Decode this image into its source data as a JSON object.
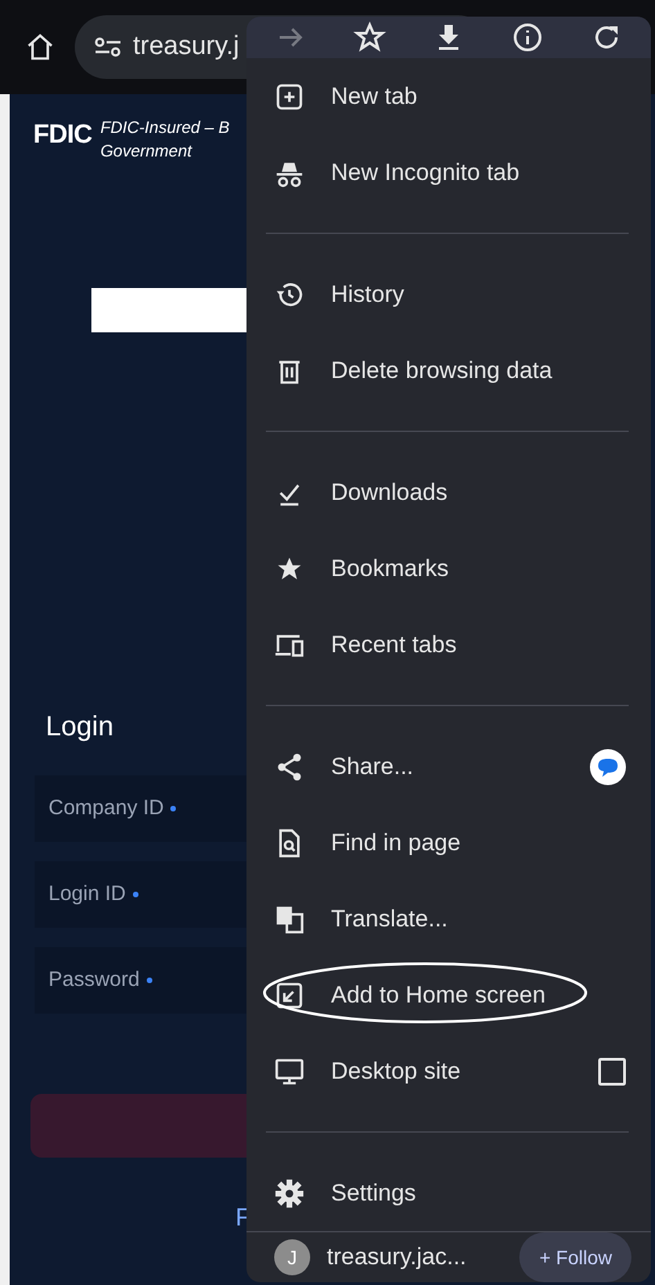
{
  "toolbar": {
    "url": "treasury.j"
  },
  "page": {
    "logo_text": "FDIC",
    "tagline": "FDIC-Insured – B",
    "tagline_2": "Government",
    "heading": "Login",
    "fields": [
      {
        "placeholder": "Company ID",
        "required": true
      },
      {
        "placeholder": "Login ID",
        "required": true
      },
      {
        "placeholder": "Password",
        "required": true
      }
    ],
    "link_fragment": "F"
  },
  "menu": {
    "top_icons": [
      {
        "disabled": true
      },
      {
        "disabled": false
      },
      {
        "disabled": false
      },
      {
        "disabled": false
      },
      {
        "disabled": false
      }
    ],
    "items": [
      {
        "kind": "item",
        "label": "New tab"
      },
      {
        "kind": "item",
        "label": "New Incognito tab"
      },
      {
        "kind": "divider"
      },
      {
        "kind": "item",
        "label": "History"
      },
      {
        "kind": "item",
        "label": "Delete browsing data"
      },
      {
        "kind": "divider"
      },
      {
        "kind": "item",
        "label": "Downloads"
      },
      {
        "kind": "item",
        "label": "Bookmarks"
      },
      {
        "kind": "item",
        "label": "Recent tabs"
      },
      {
        "kind": "divider"
      },
      {
        "kind": "share",
        "label": "Share..."
      },
      {
        "kind": "item",
        "label": "Find in page"
      },
      {
        "kind": "item",
        "label": "Translate..."
      },
      {
        "kind": "item",
        "label": "Add to Home screen",
        "circled": true
      },
      {
        "kind": "checkbox",
        "label": "Desktop site",
        "checked": false
      },
      {
        "kind": "divider"
      },
      {
        "kind": "item",
        "label": "Settings"
      }
    ],
    "footer": {
      "avatar": "J",
      "site": "treasury.jac...",
      "follow": "+ Follow"
    }
  }
}
